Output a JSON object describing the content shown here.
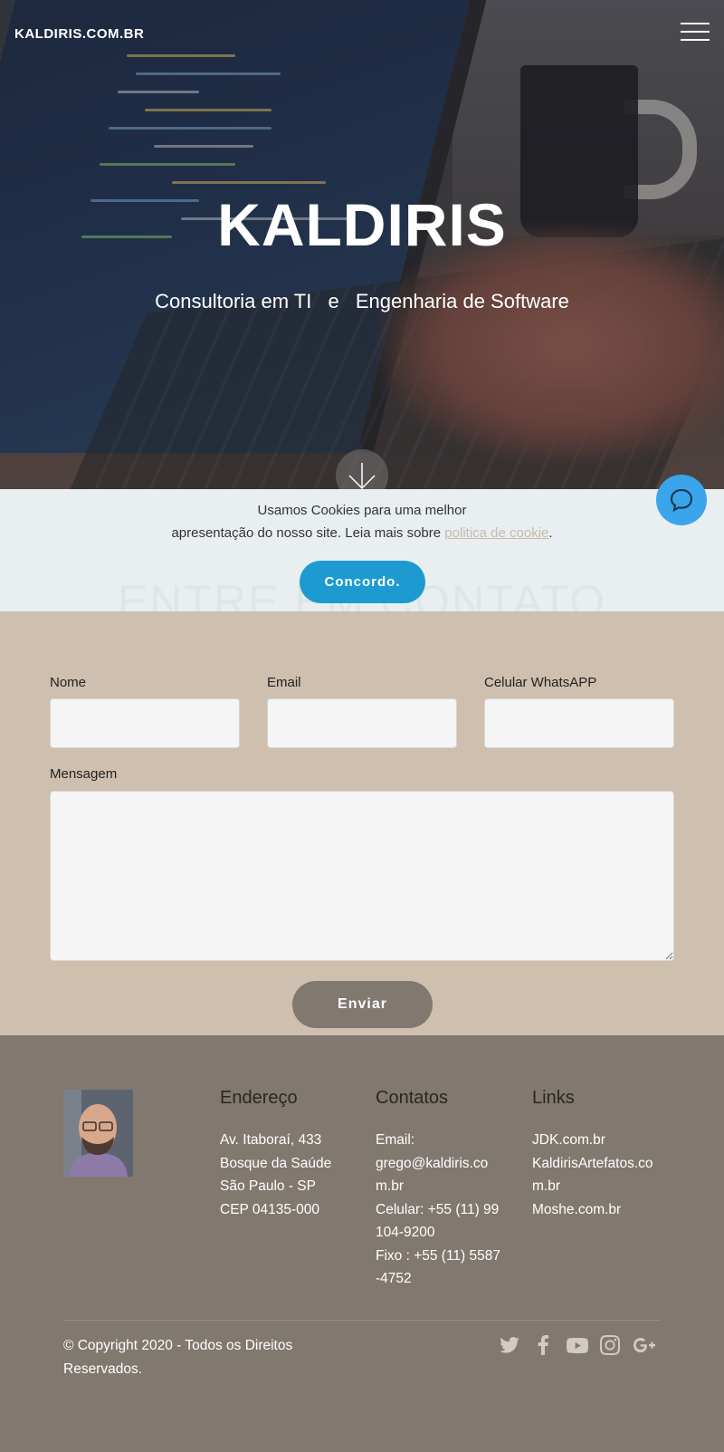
{
  "header": {
    "brand": "KALDIRIS.COM.BR",
    "menu_icon": "hamburger-icon"
  },
  "hero": {
    "title": "KALDIRIS",
    "subtitle_part1": "Consultoria em TI",
    "subtitle_sep": "e",
    "subtitle_part2": "Engenharia de Software",
    "scroll_icon": "arrow-down-icon"
  },
  "chat": {
    "icon": "chat-bubble-icon"
  },
  "cookie": {
    "line1": "Usamos Cookies para uma melhor",
    "line2": "apresentação do nosso site. Leia mais sobre",
    "link": "politica de cookie",
    "period": ".",
    "button": "Concordo.",
    "ghost_heading": "ENTRE EM CONTATO"
  },
  "form": {
    "name_label": "Nome",
    "email_label": "Email",
    "phone_label": "Celular WhatsAPP",
    "message_label": "Mensagem",
    "name_value": "",
    "email_value": "",
    "phone_value": "",
    "message_value": "",
    "submit": "Enviar"
  },
  "footer": {
    "address_title": "Endereço",
    "address_lines": [
      "Av. Itaboraí, 433",
      "Bosque da Saúde",
      "São Paulo - SP",
      "CEP 04135-000"
    ],
    "contacts_title": "Contatos",
    "contacts_lines": [
      "Email:",
      "grego@kaldiris.com.br",
      "Celular: +55 (11) 99104-9200",
      "Fixo : +55 (11) 5587-4752"
    ],
    "links_title": "Links",
    "links": [
      "JDK.com.br",
      "KaldirisArtefatos.com.br",
      "Moshe.com.br"
    ],
    "copyright": "© Copyright 2020 - Todos os Direitos Reservados.",
    "social_icons": [
      "twitter-icon",
      "facebook-icon",
      "youtube-icon",
      "instagram-icon",
      "google-plus-icon"
    ]
  },
  "colors": {
    "cookie_bg": "#e9eff1",
    "agree_button": "#1d9bd1",
    "form_bg": "#cebfaf",
    "footer_bg": "#817870",
    "chat_button": "#3aa5ea"
  }
}
